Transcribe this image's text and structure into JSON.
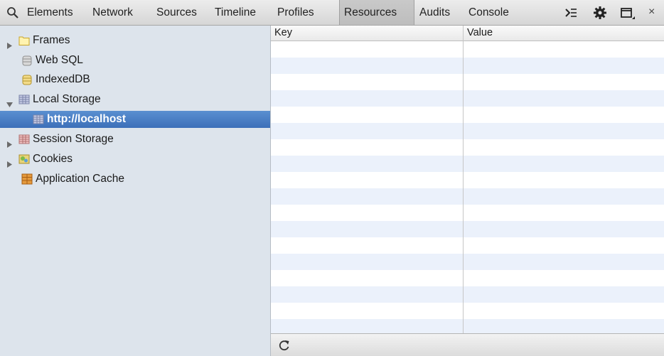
{
  "toolbar": {
    "search_icon": "search-icon",
    "tabs": [
      {
        "label": "Elements"
      },
      {
        "label": "Network"
      },
      {
        "label": "Sources"
      },
      {
        "label": "Timeline"
      },
      {
        "label": "Profiles"
      },
      {
        "label": "Resources",
        "active": true
      },
      {
        "label": "Audits"
      },
      {
        "label": "Console"
      }
    ],
    "right_icons": [
      "console-drawer-icon",
      "settings-gear-icon",
      "dock-icon",
      "close-icon"
    ],
    "close_glyph": "×"
  },
  "sidebar": {
    "items": [
      {
        "label": "Frames",
        "icon": "folder-icon",
        "expandable": true,
        "expanded": false
      },
      {
        "label": "Web SQL",
        "icon": "database-icon"
      },
      {
        "label": "IndexedDB",
        "icon": "database-icon"
      },
      {
        "label": "Local Storage",
        "icon": "table-icon",
        "expandable": true,
        "expanded": true
      },
      {
        "label": "http://localhost",
        "icon": "table-icon",
        "selected": true
      },
      {
        "label": "Session Storage",
        "icon": "table-icon",
        "expandable": true,
        "expanded": false
      },
      {
        "label": "Cookies",
        "icon": "cookie-icon",
        "expandable": true,
        "expanded": false
      },
      {
        "label": "Application Cache",
        "icon": "app-cache-icon"
      }
    ]
  },
  "grid": {
    "columns": [
      {
        "label": "Key"
      },
      {
        "label": "Value"
      }
    ],
    "rows": []
  },
  "statusbar": {
    "refresh_icon": "refresh-icon",
    "refresh_glyph": "↻"
  },
  "colors": {
    "selection": "#3c6fb9",
    "sidebar_bg": "#dde4ec",
    "alt_row": "#ebf1fb"
  }
}
